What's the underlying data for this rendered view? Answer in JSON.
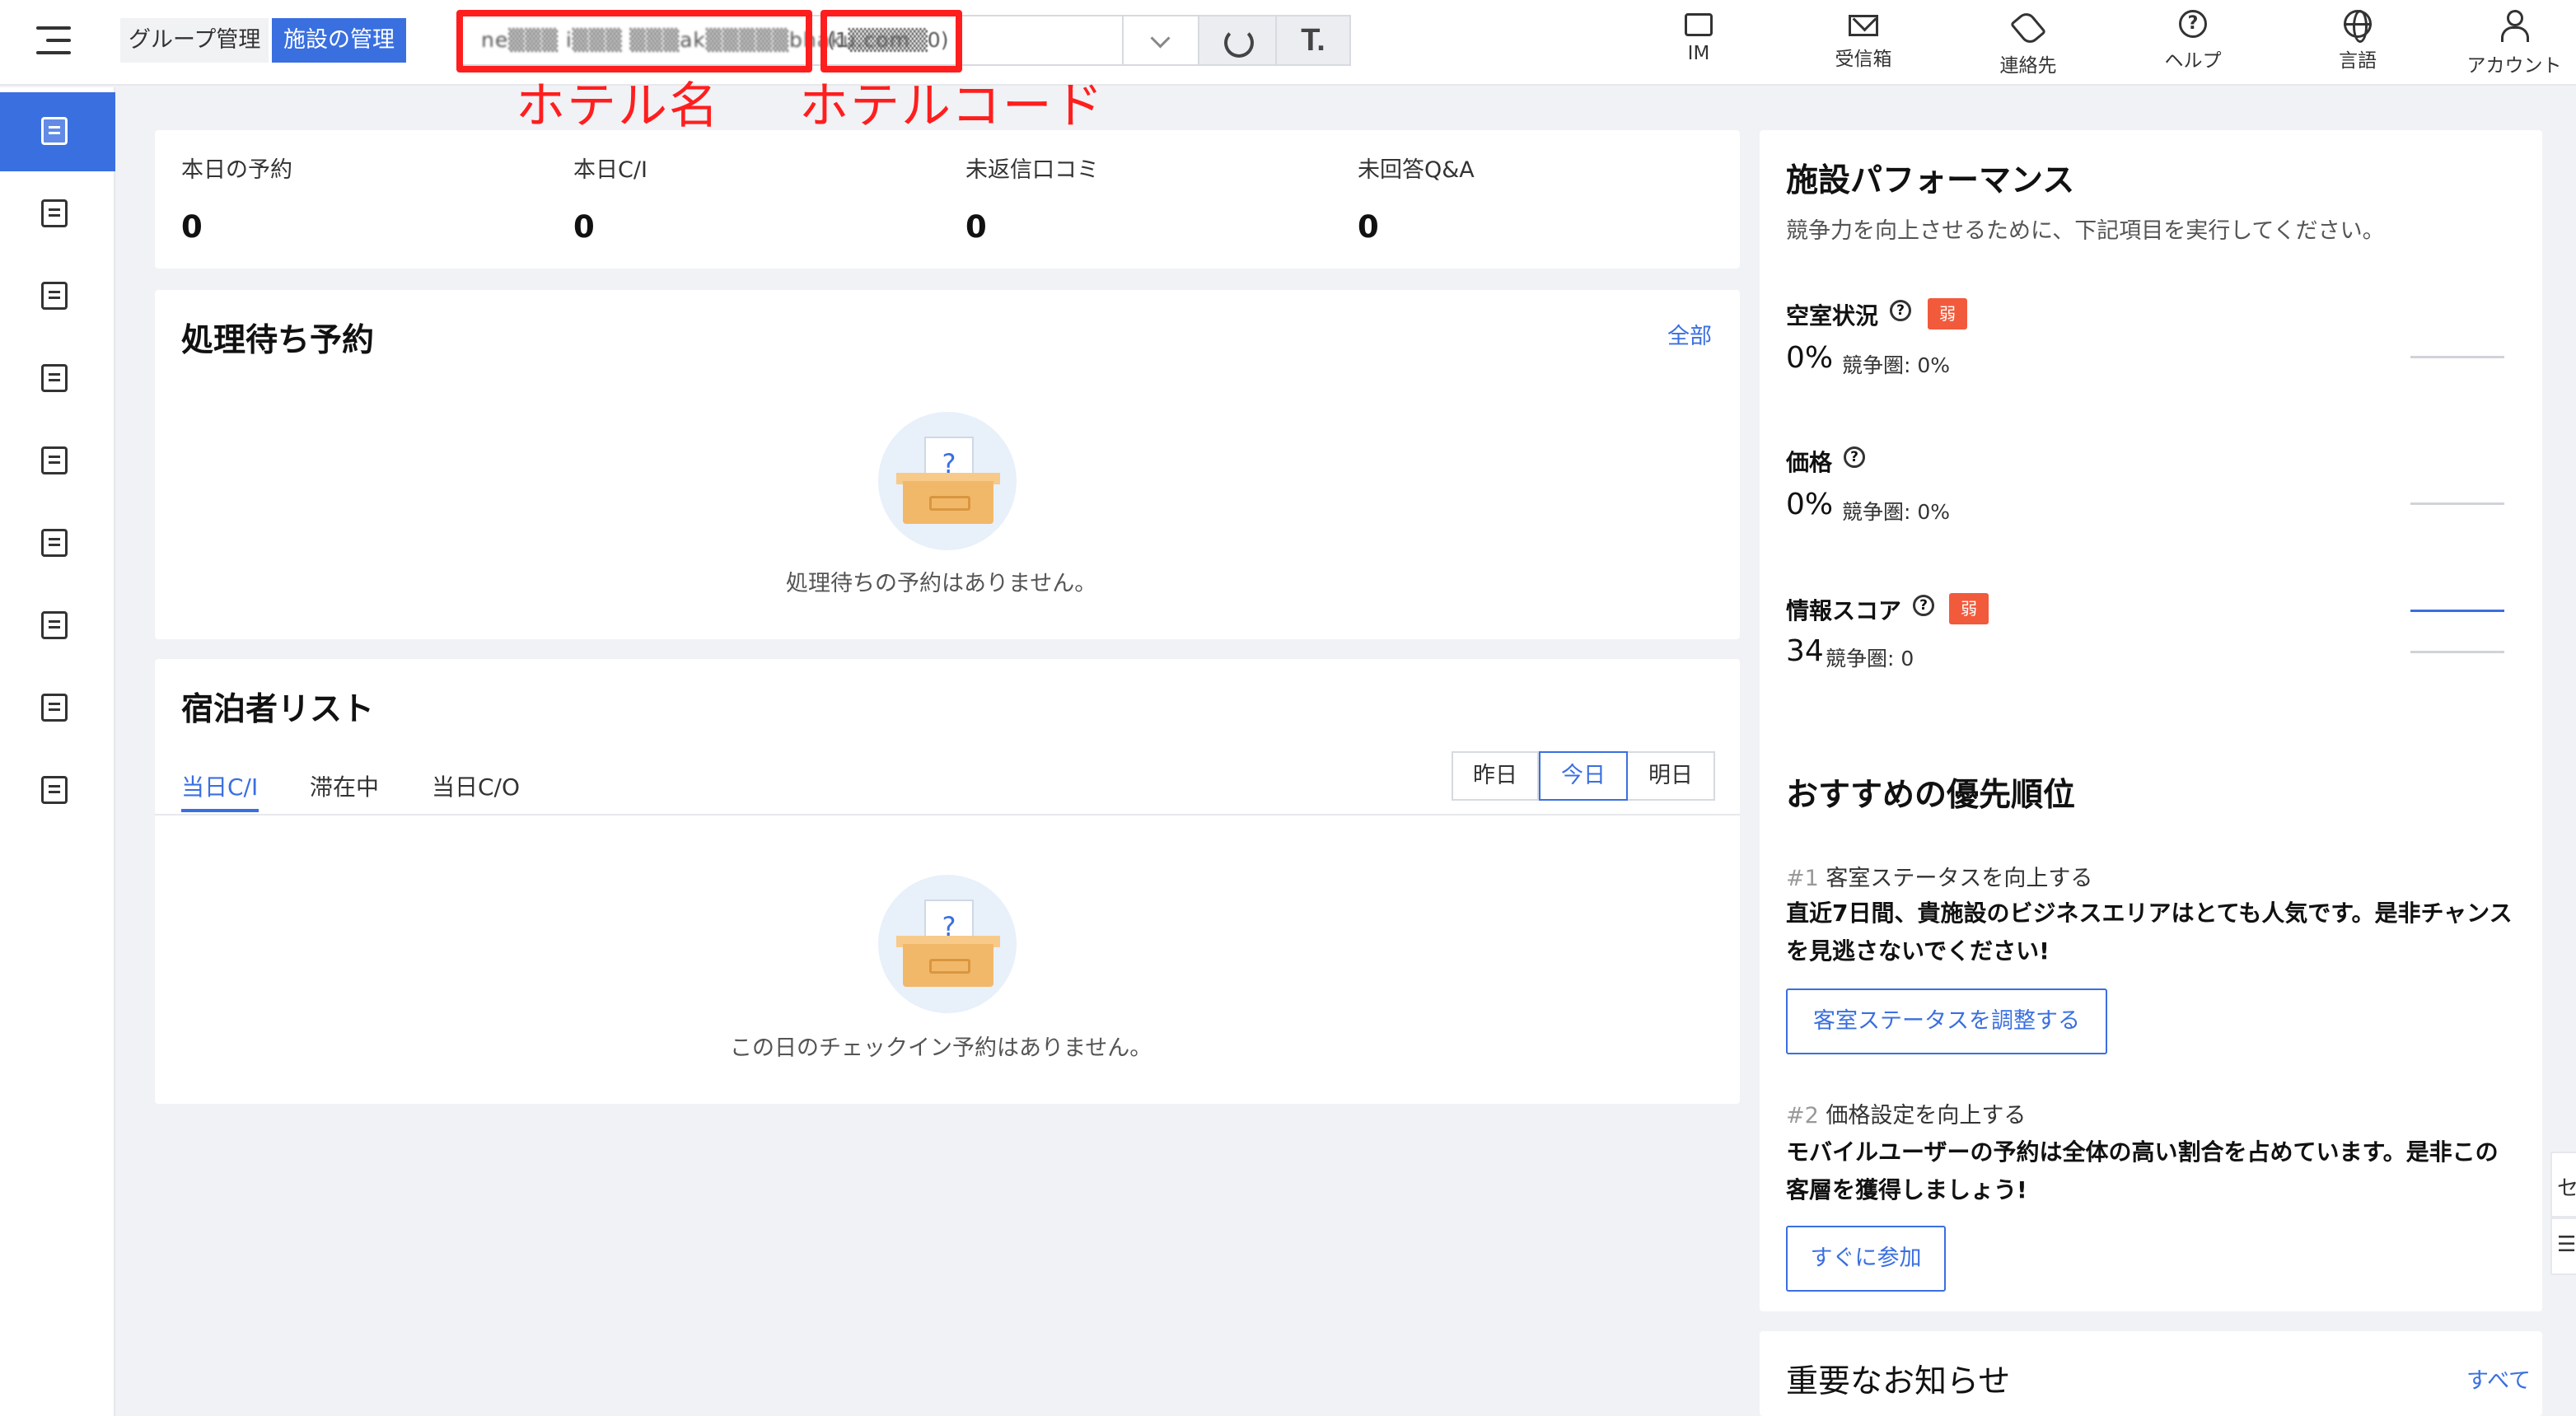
{
  "header": {
    "group_label": "グループ管理",
    "facility_label": "施設の管理",
    "hotel_name": "ne▒▒▒ i▒▒▒ ▒▒▒ak▒▒▒▒▒bhaku.com",
    "hotel_code": "(1▒▒▒▒▒0)",
    "t_button": "T.",
    "nav": [
      {
        "label": "IM",
        "icon": "chat-icon"
      },
      {
        "label": "受信箱",
        "icon": "mail-icon"
      },
      {
        "label": "連絡先",
        "icon": "phone-icon"
      },
      {
        "label": "ヘルプ",
        "icon": "help-icon"
      },
      {
        "label": "言語",
        "icon": "globe-icon"
      },
      {
        "label": "アカウント",
        "icon": "user-icon"
      }
    ]
  },
  "annotations": {
    "hotel_name": "ホテル名",
    "hotel_code": "ホテルコード",
    "color": "#ff1e1e"
  },
  "sidebar": {
    "items": [
      {
        "icon": "dashboard-icon",
        "active": true
      },
      {
        "icon": "document-icon"
      },
      {
        "icon": "home-icon"
      },
      {
        "icon": "discount-icon"
      },
      {
        "icon": "list-icon"
      },
      {
        "icon": "pie-chart-icon"
      },
      {
        "icon": "ad-icon"
      },
      {
        "icon": "person-icon"
      },
      {
        "icon": "schedule-icon"
      }
    ]
  },
  "stats": [
    {
      "label": "本日の予約",
      "value": "0"
    },
    {
      "label": "本日C/I",
      "value": "0"
    },
    {
      "label": "未返信口コミ",
      "value": "0"
    },
    {
      "label": "未回答Q&A",
      "value": "0"
    }
  ],
  "pending": {
    "title": "処理待ち予約",
    "link": "全部",
    "empty_text": "処理待ちの予約はありません。",
    "icon_mark": "?"
  },
  "guests": {
    "title": "宿泊者リスト",
    "tabs": [
      "当日C/I",
      "滞在中",
      "当日C/O"
    ],
    "days": [
      "昨日",
      "今日",
      "明日"
    ],
    "empty_text": "この日のチェックイン予約はありません。",
    "icon_mark": "?"
  },
  "performance": {
    "title": "施設パフォーマンス",
    "subtitle": "競争力を向上させるために、下記項目を実行してください。",
    "metrics": [
      {
        "label": "空室状況",
        "badge": "弱",
        "value": "0%",
        "comp": "競争圏: 0%"
      },
      {
        "label": "価格",
        "badge": "",
        "value": "0%",
        "comp": "競争圏: 0%"
      },
      {
        "label": "情報スコア",
        "badge": "弱",
        "value": "34",
        "comp": "競争圏: 0"
      }
    ],
    "help_mark": "?"
  },
  "recommend": {
    "title": "おすすめの優先順位",
    "items": [
      {
        "num": "#1",
        "head": "客室ステータスを向上する",
        "body1": "直近7日間、貴施設のビジネスエリアはとても人気です。是非チャンス",
        "body2": "を見逃さないでください!",
        "button": "客室ステータスを調整する"
      },
      {
        "num": "#2",
        "head": "価格設定を向上する",
        "body1": "モバイルユーザーの予約は全体の高い割合を占めています。是非この",
        "body2": "客層を獲得しましょう!",
        "button": "すぐに参加"
      }
    ]
  },
  "notice": {
    "title": "重要なお知らせ",
    "link": "すべて"
  },
  "edge": {
    "top": "セ",
    "bottom": "☰"
  }
}
